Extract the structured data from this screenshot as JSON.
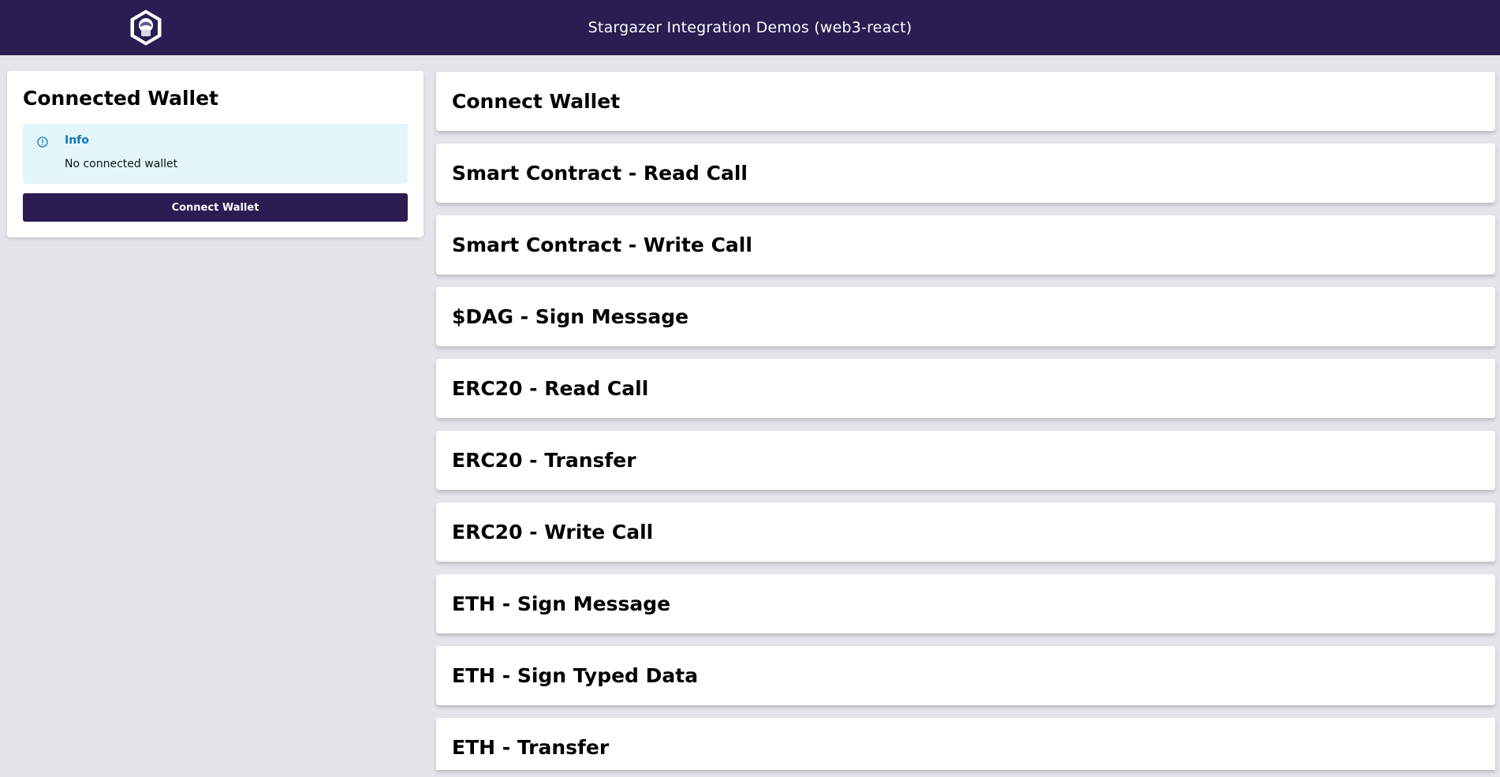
{
  "header": {
    "title": "Stargazer Integration Demos (web3-react)",
    "logo_icon": "stargazer-logo-icon"
  },
  "wallet_panel": {
    "title": "Connected Wallet",
    "info_label": "Info",
    "info_text": "No connected wallet",
    "info_icon": "info-circle-icon",
    "button_label": "Connect Wallet"
  },
  "demos": [
    {
      "title": "Connect Wallet"
    },
    {
      "title": "Smart Contract - Read Call"
    },
    {
      "title": "Smart Contract - Write Call"
    },
    {
      "title": "$DAG - Sign Message"
    },
    {
      "title": "ERC20 - Read Call"
    },
    {
      "title": "ERC20 - Transfer"
    },
    {
      "title": "ERC20 - Write Call"
    },
    {
      "title": "ETH - Sign Message"
    },
    {
      "title": "ETH - Sign Typed Data"
    },
    {
      "title": "ETH - Transfer"
    }
  ],
  "colors": {
    "brand": "#2b1c52",
    "background": "#e6e3ea",
    "info_bg": "#e3f4fb",
    "info_accent": "#0b7ac2"
  }
}
